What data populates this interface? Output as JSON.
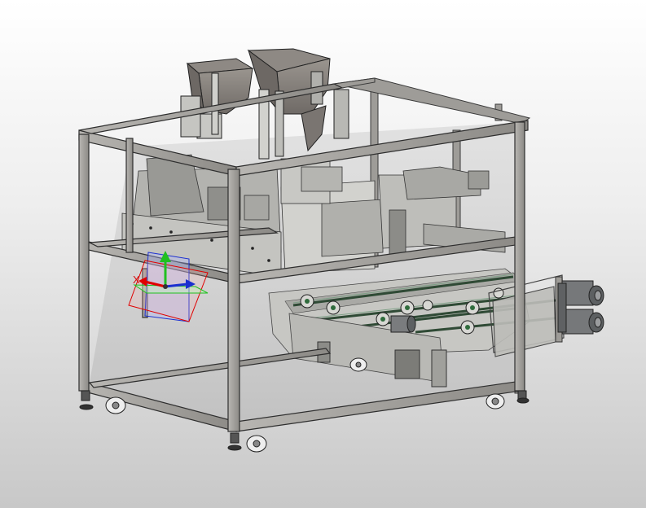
{
  "viewport": {
    "background_top": "#ffffff",
    "background_bottom": "#c8c8c8"
  },
  "model": {
    "frame_color": "#9a9894",
    "frame_edge": "#3a3a3a",
    "sheet_metal_color": "#b7b7b3",
    "hopper_color": "#8a8580",
    "motor_color": "#77787a",
    "belt_color": "#4f6a57",
    "roller_accent": "#2f6b3c"
  },
  "triad": {
    "x_label": "X",
    "x_color": "#e00000",
    "y_color": "#20c020",
    "z_color": "#1b2fd0",
    "plane_color": "#b0b6ff"
  }
}
